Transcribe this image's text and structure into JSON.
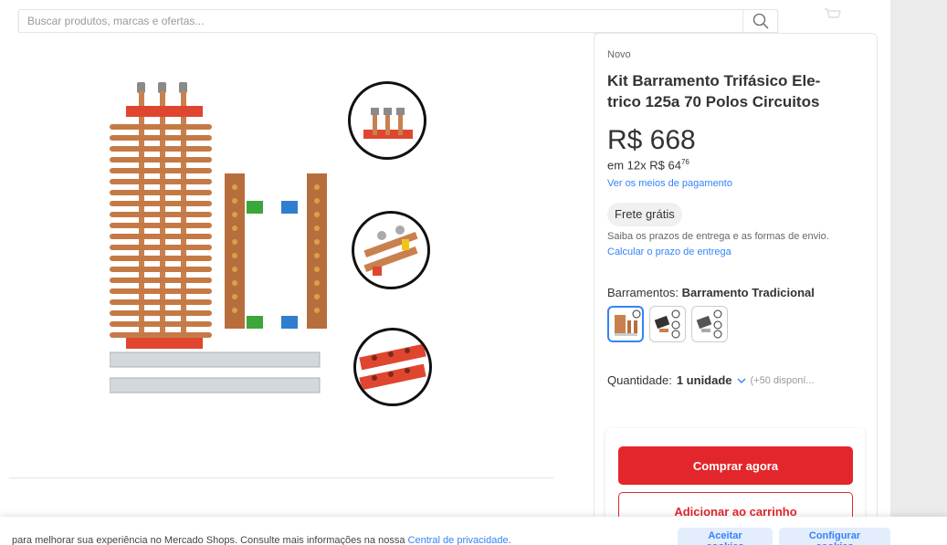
{
  "search": {
    "placeholder": "Buscar produtos, marcas e ofertas...",
    "icon": "search-icon"
  },
  "product": {
    "condition": "Novo",
    "title": "Kit Barramento Trifásico Ele-trico 125a 70 Polos Circuitos",
    "price": "R$ 668",
    "installments_prefix": "em 12x R$ 64",
    "installments_cents": "76",
    "payment_link": "Ver os meios de pagamento",
    "shipping_badge": "Frete grátis",
    "shipping_info": "Saiba os prazos de entrega e as formas de envio.",
    "calc_link": "Calcular o prazo de entrega",
    "variation_label": "Barramentos: ",
    "variation_value": "Barramento Tradicional",
    "quantity_label": "Quantidade: ",
    "quantity_value": "1 unidade",
    "quantity_available": "(+50 disponí..."
  },
  "actions": {
    "buy_now": "Comprar agora",
    "add_to_cart": "Adicionar ao carrinho"
  },
  "cookie": {
    "text": "para melhorar sua experiência no Mercado Shops. Consulte mais informações na nossa ",
    "privacy_link": "Central de privacidade",
    "privacy_suffix": ".",
    "accept": "Aceitar cookies",
    "configure": "Configurar cookies"
  },
  "colors": {
    "accent": "#3483fa",
    "buy": "#e3262b",
    "copper": "#c8814e",
    "red_block": "#e0462f"
  }
}
